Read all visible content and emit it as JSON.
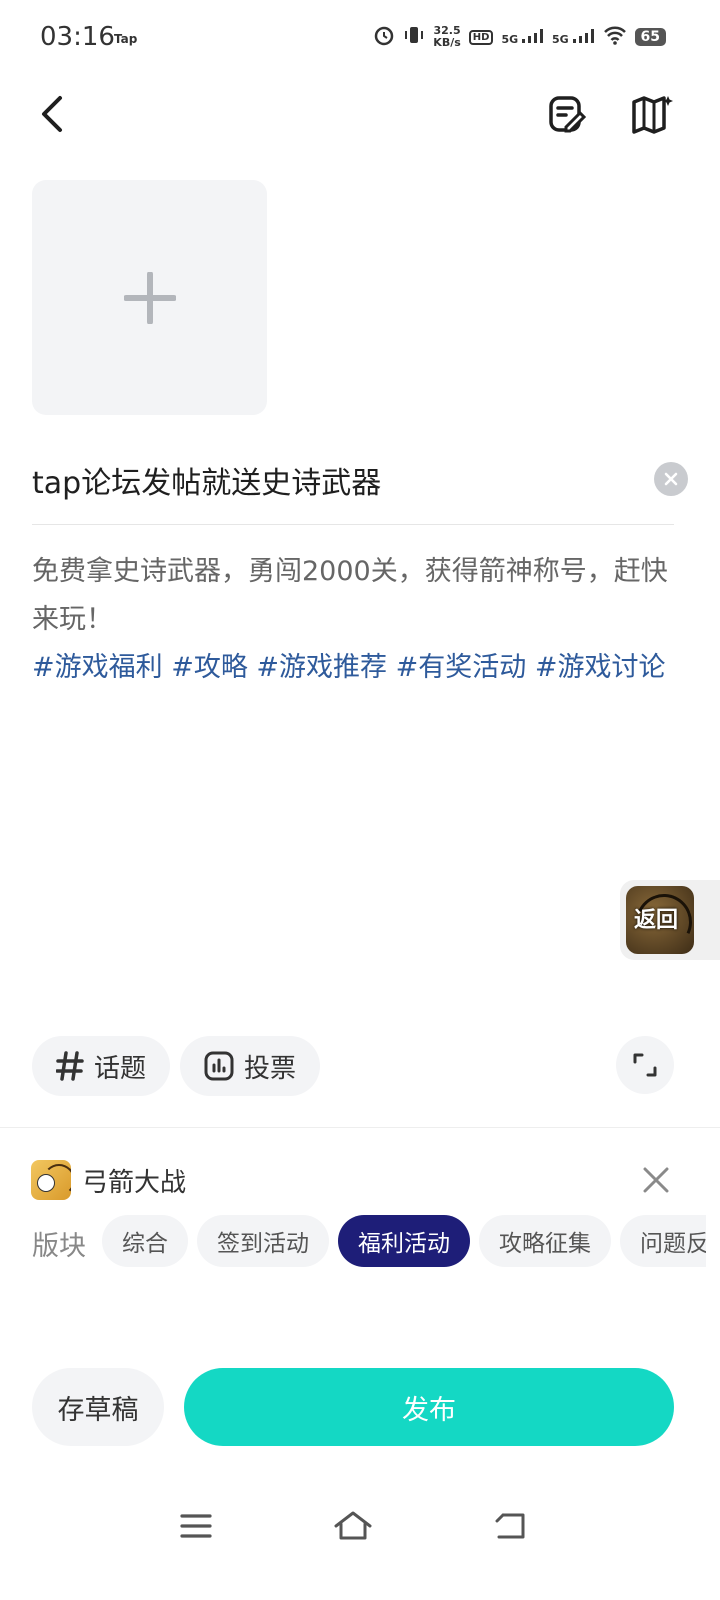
{
  "status_bar": {
    "time": "03:16",
    "app_tag": "Tap",
    "net_speed_value": "32.5",
    "net_speed_unit": "KB/s",
    "hd_label": "HD",
    "sim1_label": "5G",
    "sim2_label": "5G",
    "battery": "65"
  },
  "post": {
    "title": "tap论坛发帖就送史诗武器",
    "body_text": "免费拿史诗武器，勇闯2000关，获得箭神称号，赶快来玩！",
    "tags": "#游戏福利 #攻略 #游戏推荐 #有奖活动 #游戏讨论"
  },
  "float_return": {
    "label": "返回"
  },
  "toolbar": {
    "topic_label": "话题",
    "vote_label": "投票"
  },
  "game": {
    "name": "弓箭大战"
  },
  "section": {
    "label": "版块",
    "chips": [
      "综合",
      "签到活动",
      "福利活动",
      "攻略征集",
      "问题反馈"
    ],
    "selected": "福利活动"
  },
  "actions": {
    "save_draft_label": "存草稿",
    "publish_label": "发布"
  },
  "colors": {
    "accent": "#14d8c4",
    "selected_chip": "#1e1e78",
    "tag_link": "#2e5a9b"
  }
}
